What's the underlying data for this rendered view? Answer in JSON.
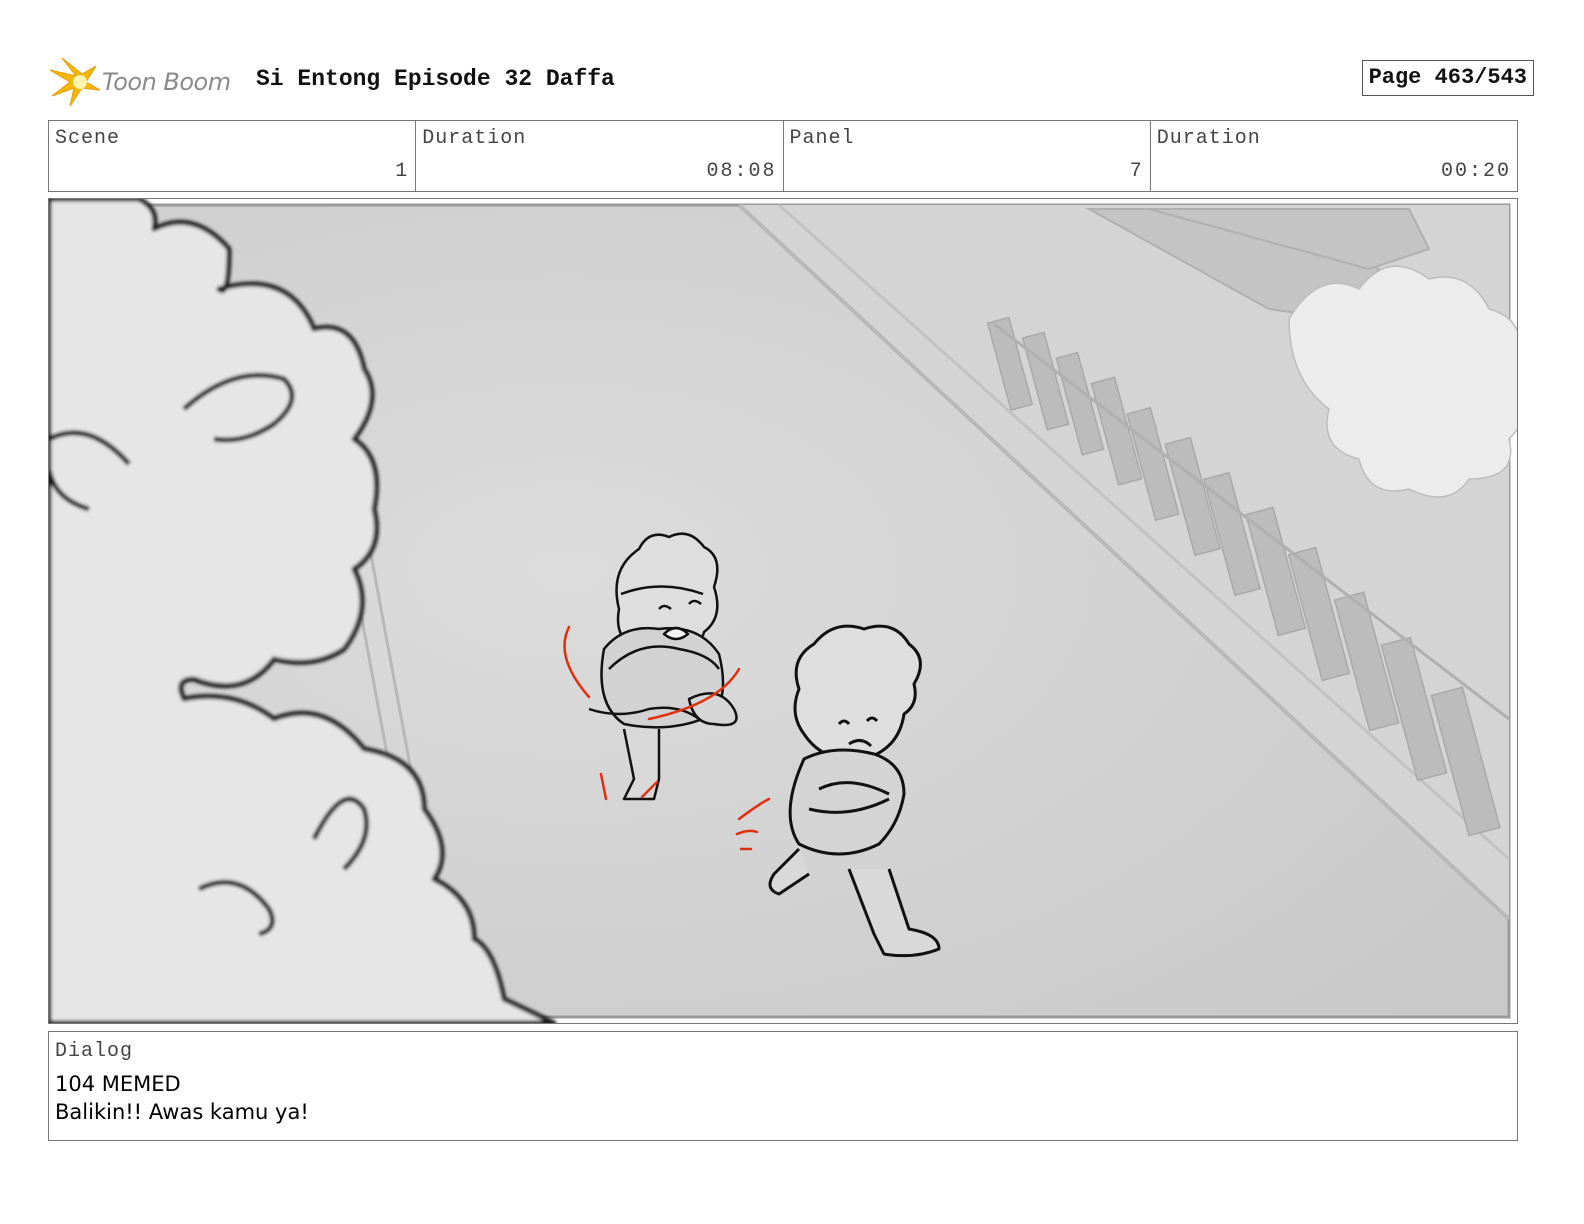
{
  "header": {
    "logo_text": "Toon Boom",
    "doc_title": "Si Entong Episode 32 Daffa",
    "page": "Page 463/543"
  },
  "info": {
    "scene_label": "Scene",
    "scene_value": "1",
    "scene_duration_label": "Duration",
    "scene_duration_value": "08:08",
    "panel_label": "Panel",
    "panel_value": "7",
    "panel_duration_label": "Duration",
    "panel_duration_value": "00:20"
  },
  "dialog": {
    "label": "Dialog",
    "lines": [
      "104 MEMED",
      "Balikin!! Awas kamu ya!"
    ]
  },
  "colors": {
    "logo_accent": "#f5b800",
    "action_lines": "#e03010"
  }
}
